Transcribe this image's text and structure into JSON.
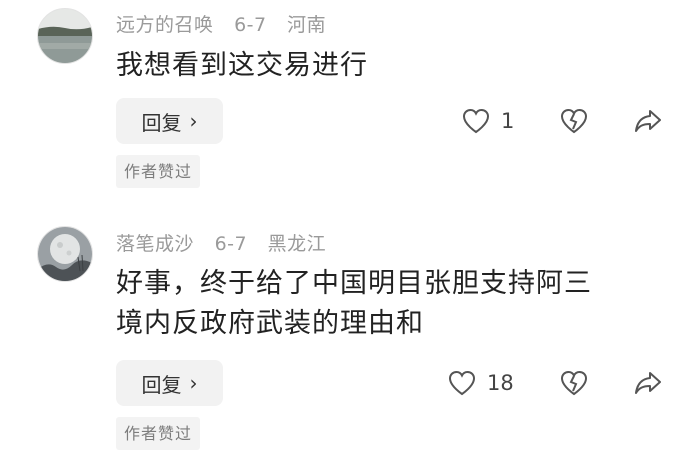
{
  "comments": [
    {
      "username": "远方的召唤",
      "date": "6-7",
      "location": "河南",
      "text": "我想看到这交易进行",
      "reply_label": "回复",
      "like_count": "1",
      "badge": "作者赞过",
      "avatar_icon": "lake-landscape-icon"
    },
    {
      "username": "落笔成沙",
      "date": "6-7",
      "location": "黑龙江",
      "text_line1": "好事，终于给了中国明目张胆支持阿三",
      "text_line2": "境内反政府武装的理由和",
      "reply_label": "回复",
      "like_count": "18",
      "badge": "作者赞过",
      "avatar_icon": "moon-night-icon"
    }
  ],
  "icons": {
    "like": "heart-outline-icon",
    "dislike": "broken-heart-icon",
    "share": "share-arrow-icon",
    "reply_arrow": "chevron-right-icon"
  }
}
